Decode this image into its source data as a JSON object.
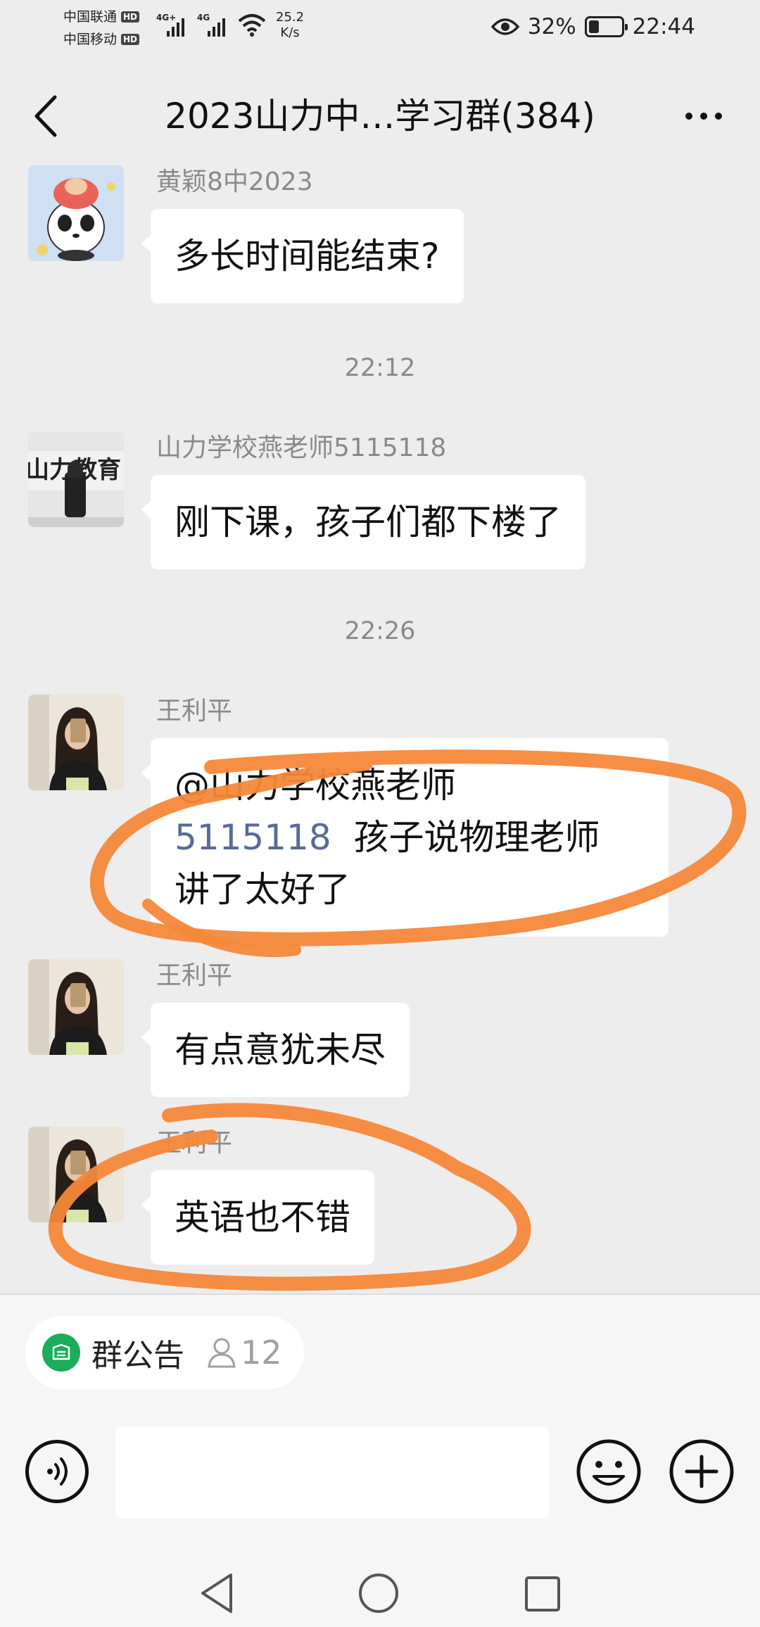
{
  "status_bar": {
    "carrier_1": "中国联通",
    "carrier_2": "中国移动",
    "hd_badge": "HD",
    "network_1": "4G+",
    "network_2": "4G",
    "speed_value": "25.2",
    "speed_unit": "K/s",
    "battery_percent": "32%",
    "battery_level": 0.32,
    "time": "22:44",
    "icons": [
      "eye-icon",
      "wifi-icon",
      "battery-icon"
    ]
  },
  "header": {
    "title": "2023山力中…学习群(384)",
    "icons": [
      "back-arrow-icon",
      "more-icon"
    ]
  },
  "messages": [
    {
      "sender": "黄颖8中2023",
      "text": "多长时间能结束?"
    },
    {
      "time": "22:12"
    },
    {
      "sender": "山力学校燕老师5115118",
      "text": "刚下课，孩子们都下楼了"
    },
    {
      "time": "22:26"
    },
    {
      "sender": "王利平",
      "mention": "@山力学校燕老师5115118",
      "text_line1_rest": "孩子说物理老师",
      "text_line2": "讲了太好了"
    },
    {
      "sender": "王利平",
      "text": "有点意犹未尽"
    },
    {
      "sender": "王利平",
      "text": "英语也不错"
    }
  ],
  "mention_display": {
    "line1": "@山力学校燕老师",
    "line2_part": "5115118"
  },
  "avatars": {
    "school_logo_text": "山力教育"
  },
  "bottom": {
    "notice_label": "群公告",
    "member_count": "12",
    "input_value": "",
    "icons": [
      "voice-icon",
      "emoji-icon",
      "add-icon"
    ]
  },
  "nav": {
    "icons": [
      "nav-back-icon",
      "nav-home-icon",
      "nav-recent-icon"
    ]
  },
  "colors": {
    "background": "#ededed",
    "bubble": "#ffffff",
    "mention": "#576b95",
    "annotation": "#f5883a",
    "notice_green": "#1aad5a"
  }
}
